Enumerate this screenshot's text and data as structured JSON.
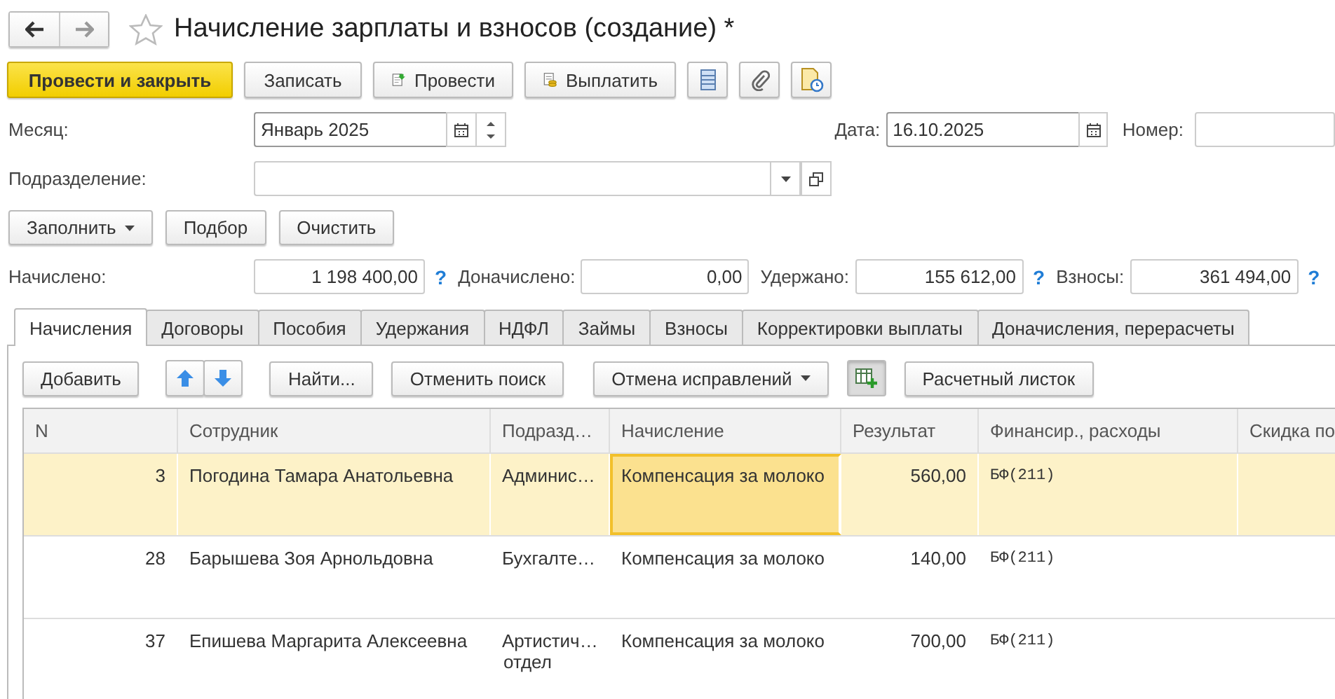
{
  "window": {
    "title": "Начисление зарплаты и взносов (создание) *"
  },
  "toolbar": {
    "post_and_close": "Провести и закрыть",
    "save": "Записать",
    "post": "Провести",
    "pay": "Выплатить"
  },
  "month": {
    "label": "Месяц:",
    "value": "Январь 2025"
  },
  "date": {
    "label": "Дата:",
    "value": "16.10.2025"
  },
  "number": {
    "label": "Номер:"
  },
  "department": {
    "label": "Подразделение:"
  },
  "fill_buttons": [
    {
      "label": "Заполнить",
      "dropdown": true
    },
    {
      "label": "Подбор",
      "dropdown": false
    },
    {
      "label": "Очистить",
      "dropdown": false
    }
  ],
  "totals": [
    {
      "label": "Начислено:",
      "value": "1 198 400,00",
      "help": "?"
    },
    {
      "label": "Доначислено:",
      "value": "0,00"
    },
    {
      "label": "Удержано:",
      "value": "155 612,00",
      "help": "?"
    },
    {
      "label": "Взносы:",
      "value": "361 494,00",
      "help": "?"
    }
  ],
  "tabs": [
    {
      "label": "Начисления",
      "selected": true
    },
    {
      "label": "Договоры",
      "selected": false
    },
    {
      "label": "Пособия",
      "selected": false
    },
    {
      "label": "Удержания",
      "selected": false
    },
    {
      "label": "НДФЛ",
      "selected": false
    },
    {
      "label": "Займы",
      "selected": false
    },
    {
      "label": "Взносы",
      "selected": false
    },
    {
      "label": "Корректировки выплаты",
      "selected": false
    },
    {
      "label": "Доначисления, перерасчеты",
      "selected": false
    }
  ],
  "table_toolbar": {
    "add": "Добавить",
    "find": "Найти...",
    "cancel_search": "Отменить поиск",
    "undo_fixes": "Отмена исправлений",
    "grid_toggle_pressed": true,
    "payslip": "Расчетный листок"
  },
  "table": {
    "columns": [
      "N",
      "Сотрудник",
      "Подразд…",
      "Начисление",
      "Результат",
      "Финансир., расходы",
      "Скидка по"
    ],
    "rows": [
      {
        "n": "3",
        "employee": "Погодина Тамара Анатольевна",
        "department": [
          "Админис…"
        ],
        "accrual": "Компенсация за молоко",
        "result": "560,00",
        "financing": "БФ(211)",
        "selected": true,
        "accrual_focused": true
      },
      {
        "n": "28",
        "employee": "Барышева Зоя Арнольдовна",
        "department": [
          "Бухгалте…"
        ],
        "accrual": "Компенсация за молоко",
        "result": "140,00",
        "financing": "БФ(211)",
        "selected": false,
        "accrual_focused": false
      },
      {
        "n": "37",
        "employee": "Епишева Маргарита Алексеевна",
        "department": [
          "Артистич…",
          "отдел"
        ],
        "accrual": "Компенсация за молоко",
        "result": "700,00",
        "financing": "БФ(211)",
        "selected": false,
        "accrual_focused": false
      }
    ]
  }
}
